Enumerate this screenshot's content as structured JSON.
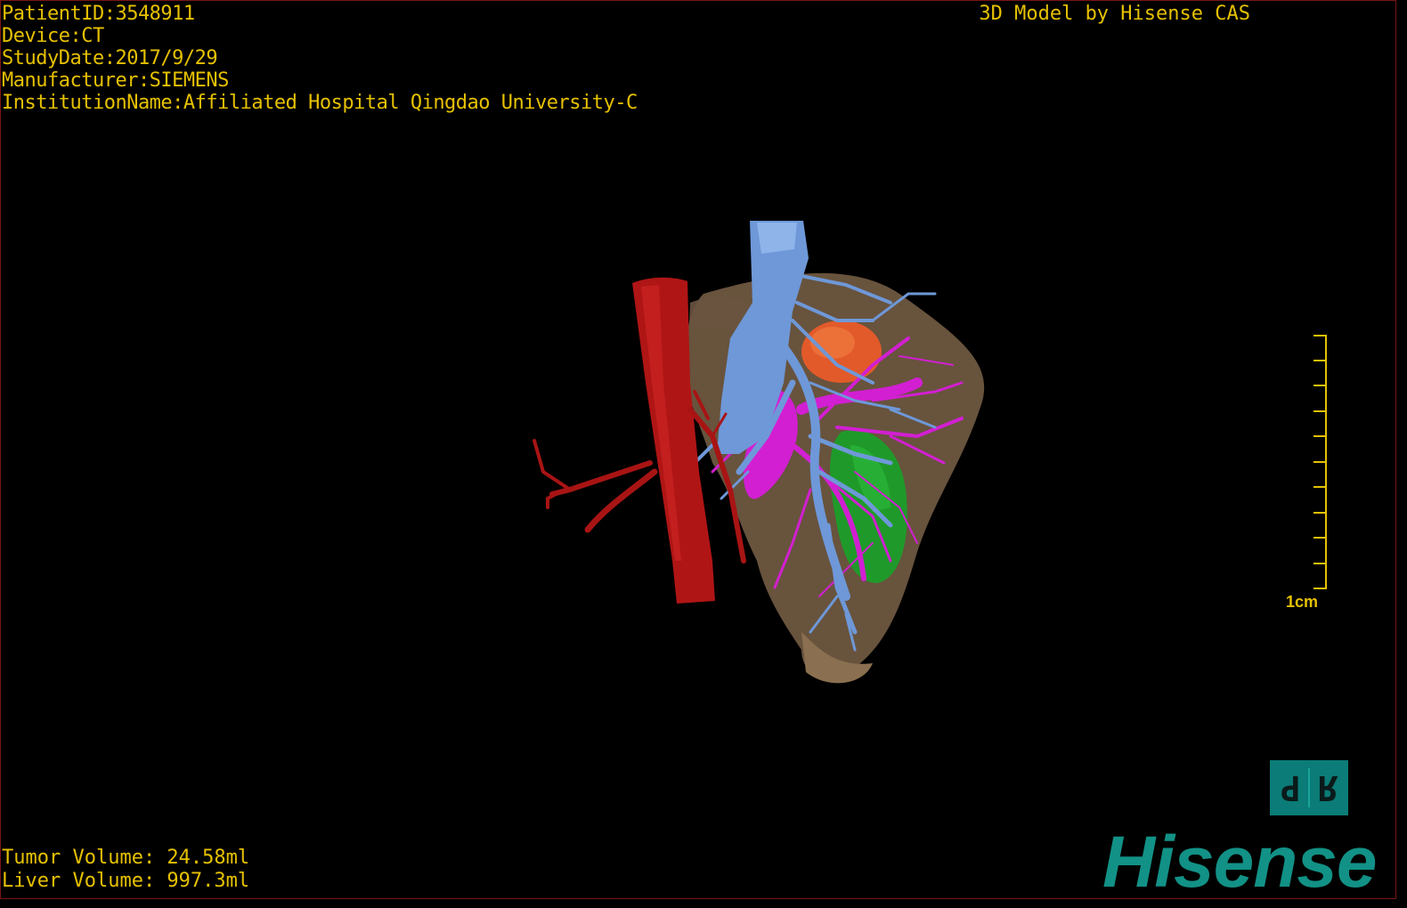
{
  "study_info": {
    "patient_id": "PatientID:3548911",
    "device": "Device:CT",
    "study_date": "StudyDate:2017/9/29",
    "manufacturer": "Manufacturer:SIEMENS",
    "institution": "InstitutionName:Affiliated Hospital Qingdao University-C"
  },
  "model_credit": "3D Model by Hisense CAS",
  "volumes": {
    "tumor": "Tumor Volume: 24.58ml",
    "liver": "Liver Volume: 997.3ml"
  },
  "scale": {
    "label": "1cm"
  },
  "orientation": {
    "face_left": "P",
    "face_right": "R"
  },
  "brand": "Hisense",
  "colors": {
    "overlay_text": "#e6c100",
    "liver": "#7a6248",
    "aorta": "#b01515",
    "portal_vein": "#6e98d8",
    "hepatic_vein": "#d21fd2",
    "tumor": "#e25a2a",
    "kidney": "#1f9a2a",
    "brand": "#129186"
  }
}
